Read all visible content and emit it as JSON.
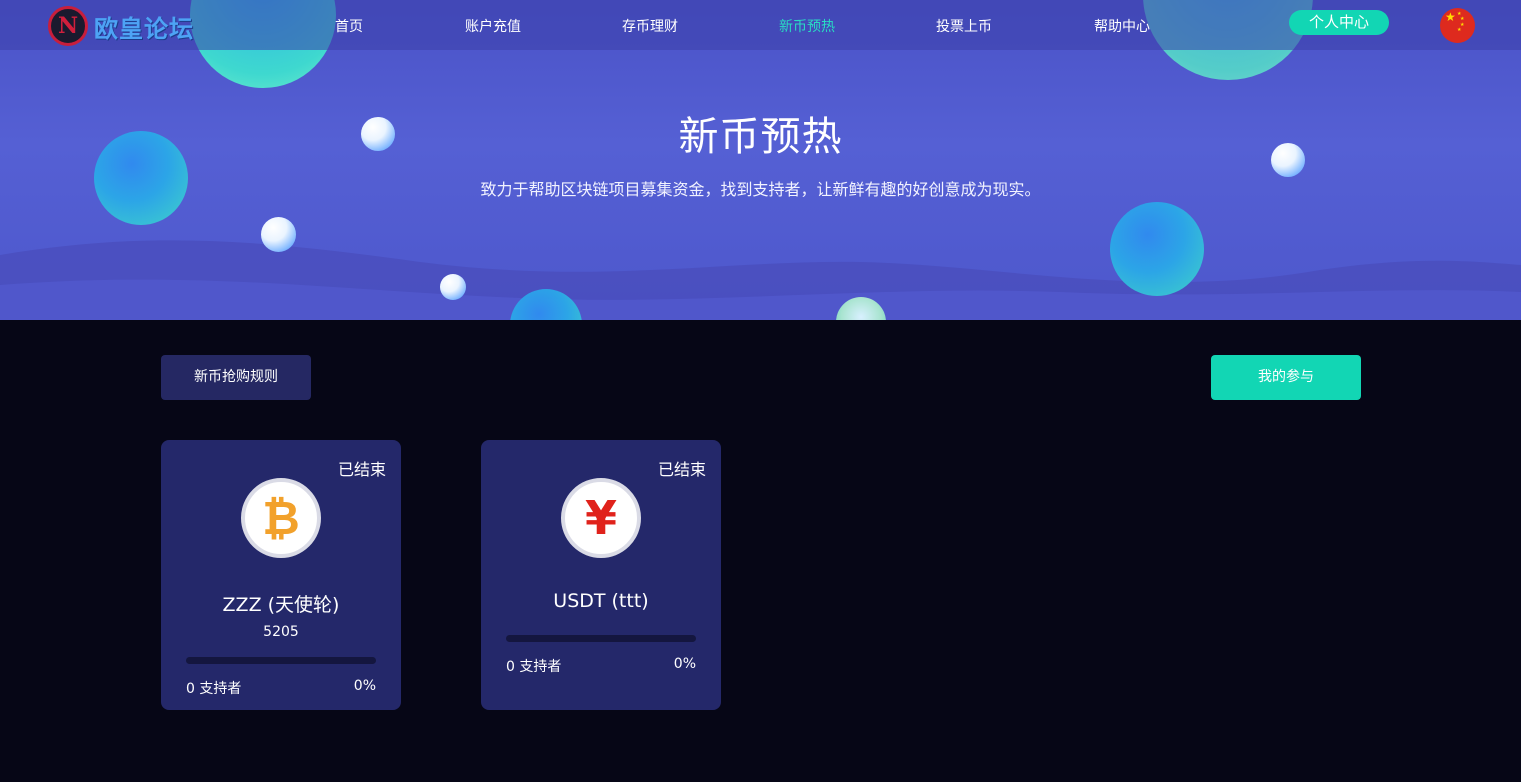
{
  "nav": {
    "logo_text": "欧皇论坛",
    "logo_mark": "N",
    "items": [
      {
        "label": "首页"
      },
      {
        "label": "账户充值"
      },
      {
        "label": "存币理财"
      },
      {
        "label": "新币预热",
        "active": true
      },
      {
        "label": "投票上币"
      },
      {
        "label": "帮助中心"
      }
    ],
    "user_center": "个人中心",
    "language_flag": "china-flag-icon"
  },
  "hero": {
    "title": "新币预热",
    "subtitle": "致力于帮助区块链项目募集资金，找到支持者，让新鲜有趣的好创意成为现实。"
  },
  "actions": {
    "rules_label": "新币抢购规则",
    "mine_label": "我的参与"
  },
  "projects": [
    {
      "status": "已结束",
      "icon": "bitcoin-icon",
      "icon_glyph": "₿",
      "name": "ZZZ (天使轮)",
      "amount": "5205",
      "supporters": "0 支持者",
      "percent": "0%",
      "progress": 0
    },
    {
      "status": "已结束",
      "icon": "yuan-icon",
      "icon_glyph": "¥",
      "name": "USDT (ttt)",
      "supporters": "0 支持者",
      "percent": "0%",
      "progress": 0
    }
  ],
  "colors": {
    "accent": "#12d6b4",
    "nav_active": "#28dcc4",
    "card_bg": "#24286a",
    "page_bg": "#060616",
    "hero_bg": "#5560d4"
  }
}
